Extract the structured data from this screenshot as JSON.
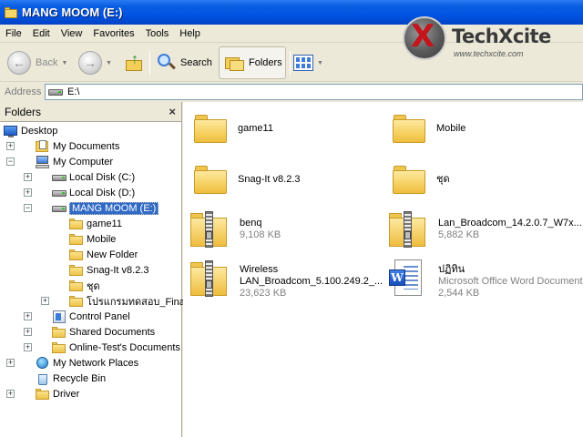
{
  "window": {
    "title": "MANG MOOM (E:)"
  },
  "menu": [
    "File",
    "Edit",
    "View",
    "Favorites",
    "Tools",
    "Help"
  ],
  "logo": {
    "brand_x": "X",
    "name": "TechXcite",
    "url": "www.techxcite.com"
  },
  "toolbar": {
    "back_label": "Back",
    "search_label": "Search",
    "folders_label": "Folders"
  },
  "address": {
    "label": "Address",
    "value": "E:\\"
  },
  "folders_pane": {
    "title": "Folders",
    "close": "×",
    "tree": [
      {
        "label": "Desktop",
        "icon": "desktop-icon",
        "expander": "",
        "level": 0
      },
      {
        "label": "My Documents",
        "icon": "my-documents-icon",
        "expander": "+",
        "level": 1
      },
      {
        "label": "My Computer",
        "icon": "my-computer-icon",
        "expander": "−",
        "level": 1
      },
      {
        "label": "Local Disk (C:)",
        "icon": "drive-icon",
        "expander": "+",
        "level": 2
      },
      {
        "label": "Local Disk (D:)",
        "icon": "drive-icon",
        "expander": "+",
        "level": 2
      },
      {
        "label": "MANG MOOM (E:)",
        "icon": "drive-icon",
        "expander": "−",
        "level": 2,
        "selected": true
      },
      {
        "label": "game11",
        "icon": "folder-icon",
        "expander": "",
        "level": 3
      },
      {
        "label": "Mobile",
        "icon": "folder-icon",
        "expander": "",
        "level": 3
      },
      {
        "label": "New Folder",
        "icon": "folder-icon",
        "expander": "",
        "level": 3
      },
      {
        "label": "Snag-It v8.2.3",
        "icon": "folder-icon",
        "expander": "",
        "level": 3
      },
      {
        "label": "ชุด",
        "icon": "folder-icon",
        "expander": "",
        "level": 3
      },
      {
        "label": "โปรแกรมทดสอบ_Final",
        "icon": "folder-icon",
        "expander": "+",
        "level": 3
      },
      {
        "label": "Control Panel",
        "icon": "control-panel-icon",
        "expander": "+",
        "level": 2
      },
      {
        "label": "Shared Documents",
        "icon": "folder-icon",
        "expander": "+",
        "level": 2
      },
      {
        "label": "Online-Test's Documents",
        "icon": "folder-icon",
        "expander": "+",
        "level": 2
      },
      {
        "label": "My Network Places",
        "icon": "network-icon",
        "expander": "+",
        "level": 1
      },
      {
        "label": "Recycle Bin",
        "icon": "recycle-bin-icon",
        "expander": "",
        "level": 1
      },
      {
        "label": "Driver",
        "icon": "folder-icon",
        "expander": "+",
        "level": 1
      }
    ]
  },
  "content": {
    "items": [
      {
        "name": "game11",
        "type": "folder"
      },
      {
        "name": "Mobile",
        "type": "folder"
      },
      {
        "name": "Snag-It v8.2.3",
        "type": "folder"
      },
      {
        "name": "ชุด",
        "type": "folder"
      },
      {
        "name": "benq",
        "type": "zip",
        "size": "9,108 KB"
      },
      {
        "name": "Lan_Broadcom_14.2.0.7_W7x...",
        "type": "zip",
        "size": "5,882 KB"
      },
      {
        "name": "Wireless",
        "name2": "LAN_Broadcom_5.100.249.2_...",
        "type": "zip",
        "size": "23,623 KB"
      },
      {
        "name": "ปฏิทิน",
        "type": "doc",
        "kind": "Microsoft Office Word Document",
        "size": "2,544 KB"
      }
    ]
  }
}
